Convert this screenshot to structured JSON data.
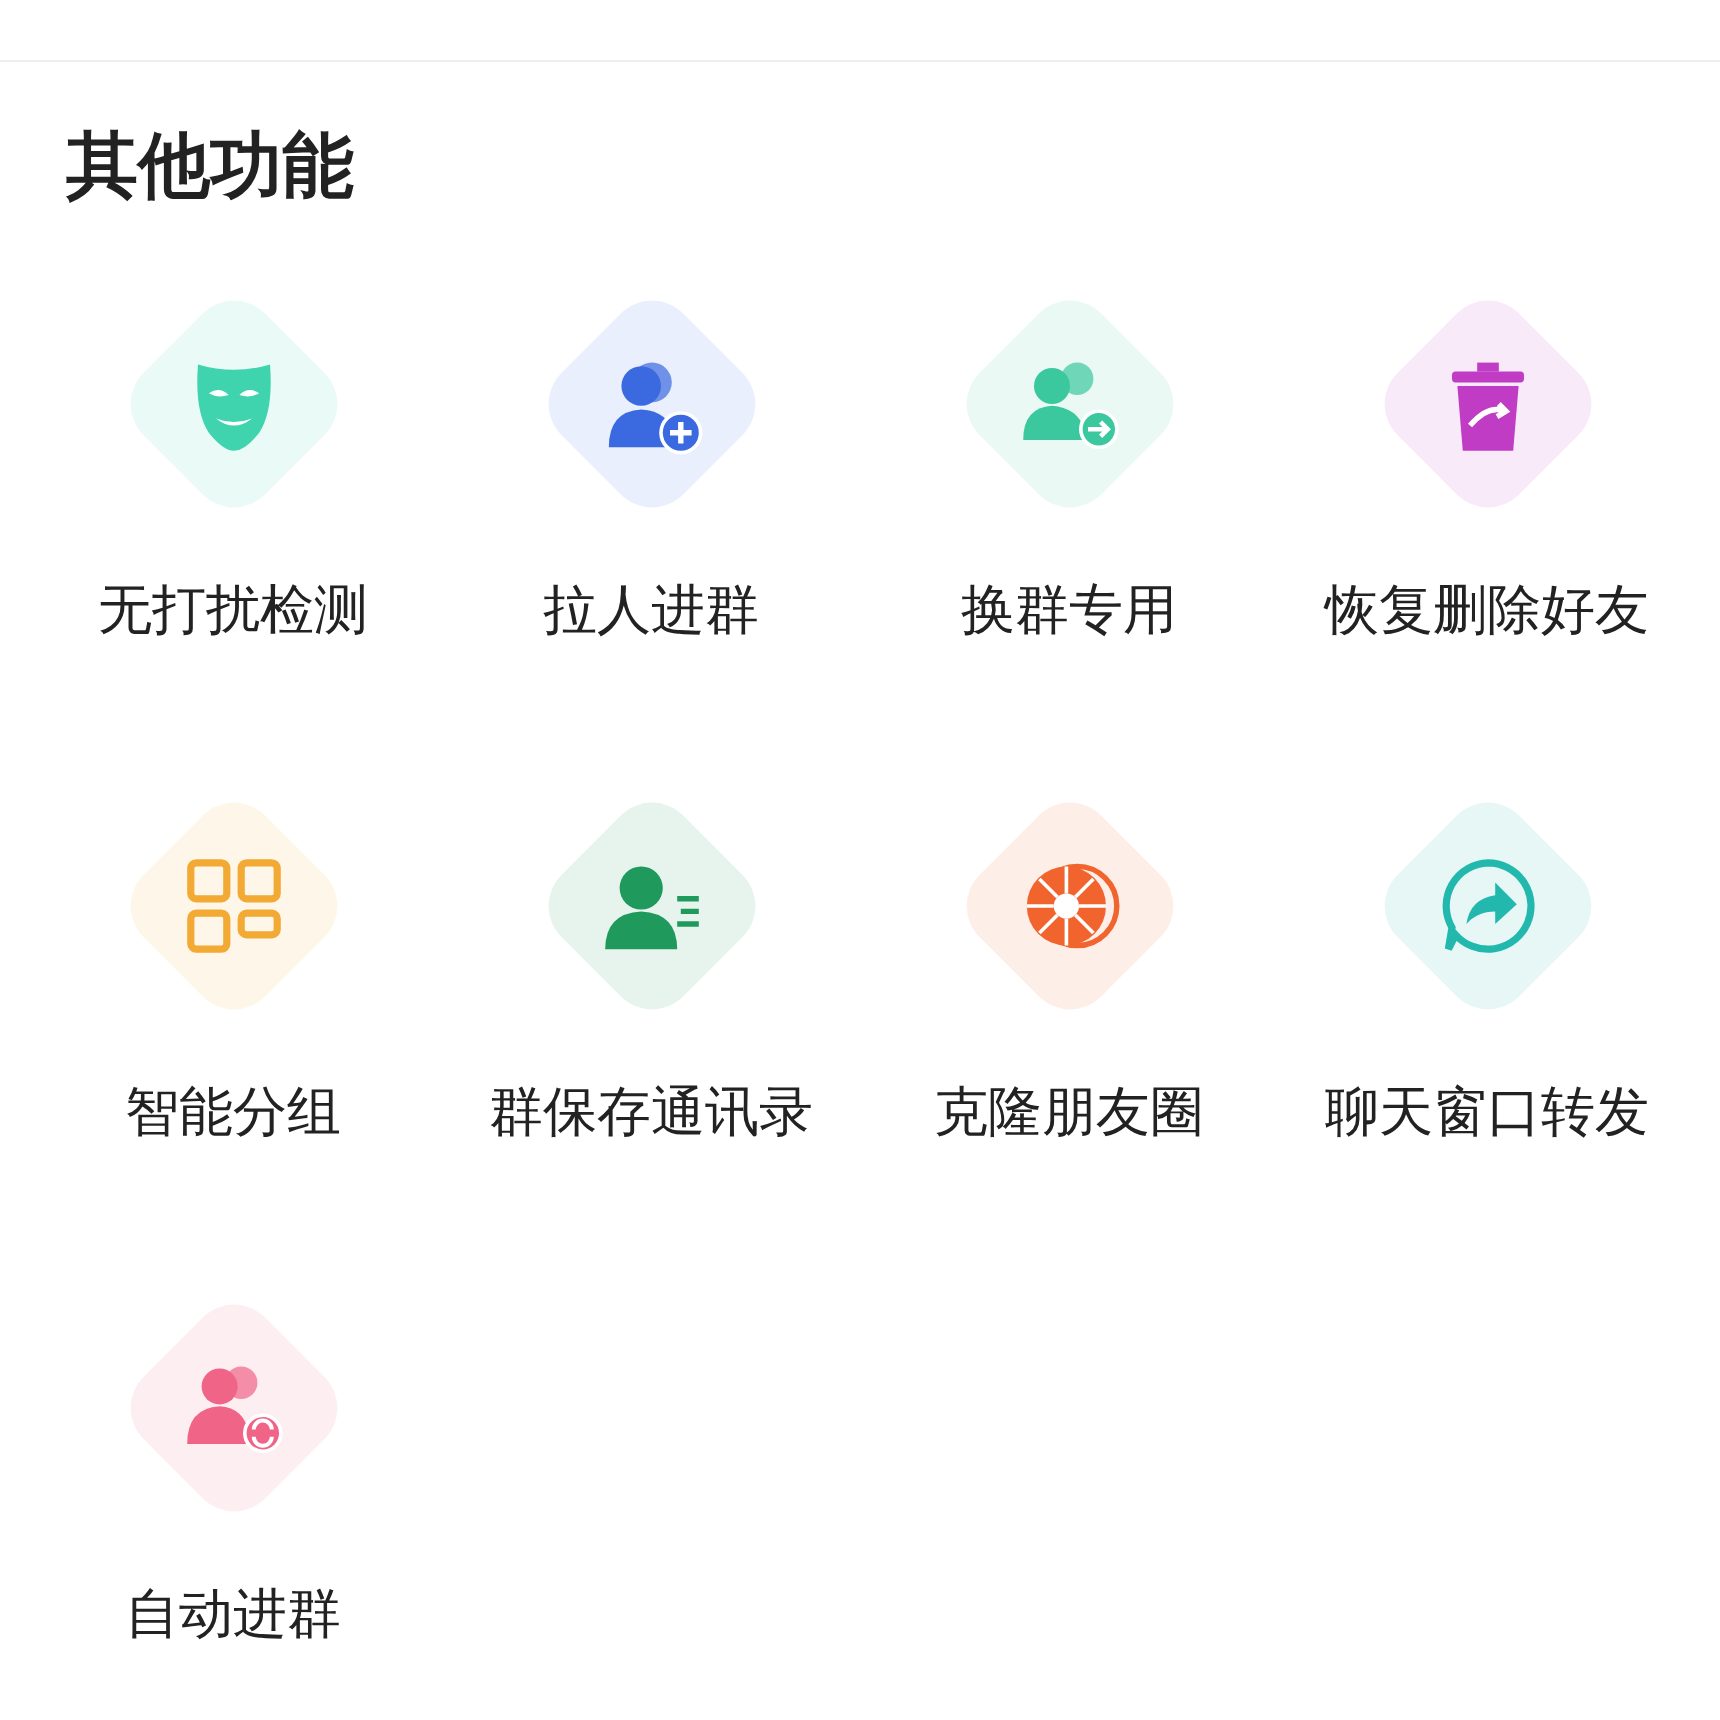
{
  "section": {
    "title": "其他功能"
  },
  "features": [
    {
      "label": "无打扰检测",
      "kind": "mask",
      "color": "#3fd4ae"
    },
    {
      "label": "拉人进群",
      "kind": "add-user",
      "color": "#3b6ae0"
    },
    {
      "label": "换群专用",
      "kind": "group-move",
      "color": "#3cc89e"
    },
    {
      "label": "恢复删除好友",
      "kind": "trash",
      "color": "#c03cc4"
    },
    {
      "label": "智能分组",
      "kind": "grid",
      "color": "#f2aa34"
    },
    {
      "label": "群保存通讯录",
      "kind": "contact",
      "color": "#1f9a5c"
    },
    {
      "label": "克隆朋友圈",
      "kind": "aperture",
      "color": "#f2642e"
    },
    {
      "label": "聊天窗口转发",
      "kind": "share",
      "color": "#22b8ae"
    },
    {
      "label": "自动进群",
      "kind": "group-sync",
      "color": "#f06487"
    }
  ]
}
